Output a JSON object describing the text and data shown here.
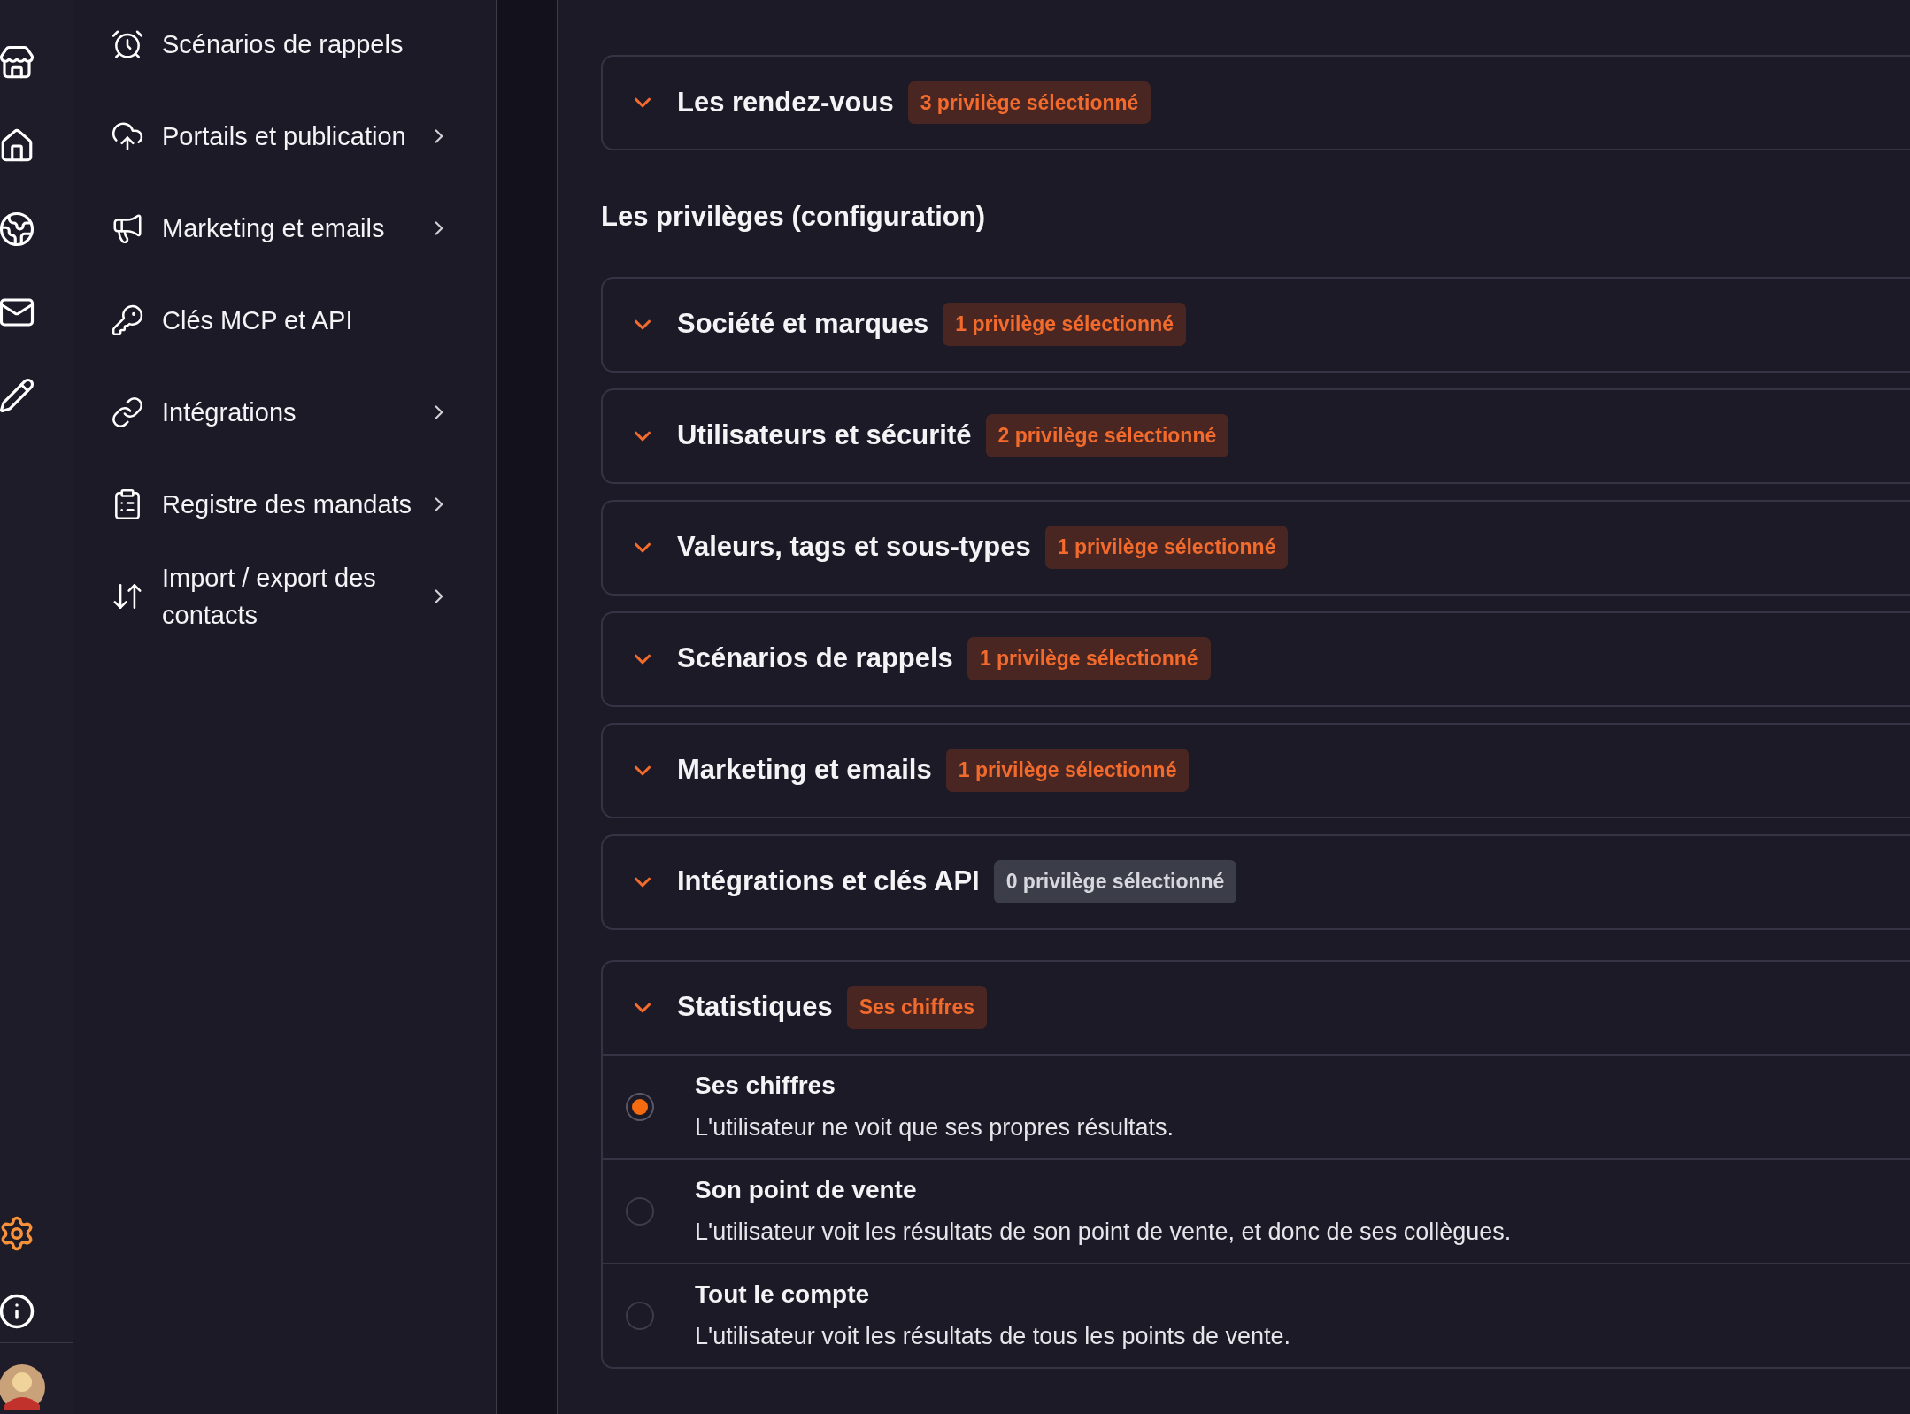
{
  "rail": {
    "items": [
      {
        "selected": false
      },
      {
        "selected": false
      },
      {
        "selected": false
      },
      {
        "selected": false
      },
      {
        "selected": false
      }
    ],
    "bottom_items": [
      {
        "selected": true
      },
      {
        "selected": false
      }
    ]
  },
  "nav": {
    "items": [
      {
        "label": "Scénarios de rappels",
        "has_submenu": false
      },
      {
        "label": "Portails et publication",
        "has_submenu": true
      },
      {
        "label": "Marketing et emails",
        "has_submenu": true
      },
      {
        "label": "Clés MCP et API",
        "has_submenu": false
      },
      {
        "label": "Intégrations",
        "has_submenu": true
      },
      {
        "label": "Registre des mandats",
        "has_submenu": true
      },
      {
        "label": "Import / export des contacts",
        "has_submenu": true
      }
    ]
  },
  "sections": [
    {
      "cards": [
        {
          "title": "Les rendez-vous",
          "badge": "3 privilège sélectionné",
          "highlighted": true
        }
      ]
    },
    {
      "heading": "Les privilèges (configuration)",
      "cards": [
        {
          "title": "Société et marques",
          "badge": "1 privilège sélectionné",
          "highlighted": true
        },
        {
          "title": "Utilisateurs et sécurité",
          "badge": "2 privilège sélectionné",
          "highlighted": true
        },
        {
          "title": "Valeurs, tags et sous-types",
          "badge": "1 privilège sélectionné",
          "highlighted": true
        },
        {
          "title": "Scénarios de rappels",
          "badge": "1 privilège sélectionné",
          "highlighted": true
        },
        {
          "title": "Marketing et emails",
          "badge": "1 privilège sélectionné",
          "highlighted": true
        },
        {
          "title": "Intégrations et clés API",
          "badge": "0 privilège sélectionné",
          "highlighted": false
        }
      ]
    }
  ],
  "statistics": {
    "title": "Statistiques",
    "badge": "Ses chiffres",
    "highlighted": true,
    "options": [
      {
        "title": "Ses chiffres",
        "description": "L'utilisateur ne voit que ses propres résultats.",
        "selected": true
      },
      {
        "title": "Son point de vente",
        "description": "L'utilisateur voit les résultats de son point de vente, et donc de ses collègues.",
        "selected": false
      },
      {
        "title": "Tout le compte",
        "description": "L'utilisateur voit les résultats de tous les points de vente.",
        "selected": false
      }
    ]
  }
}
